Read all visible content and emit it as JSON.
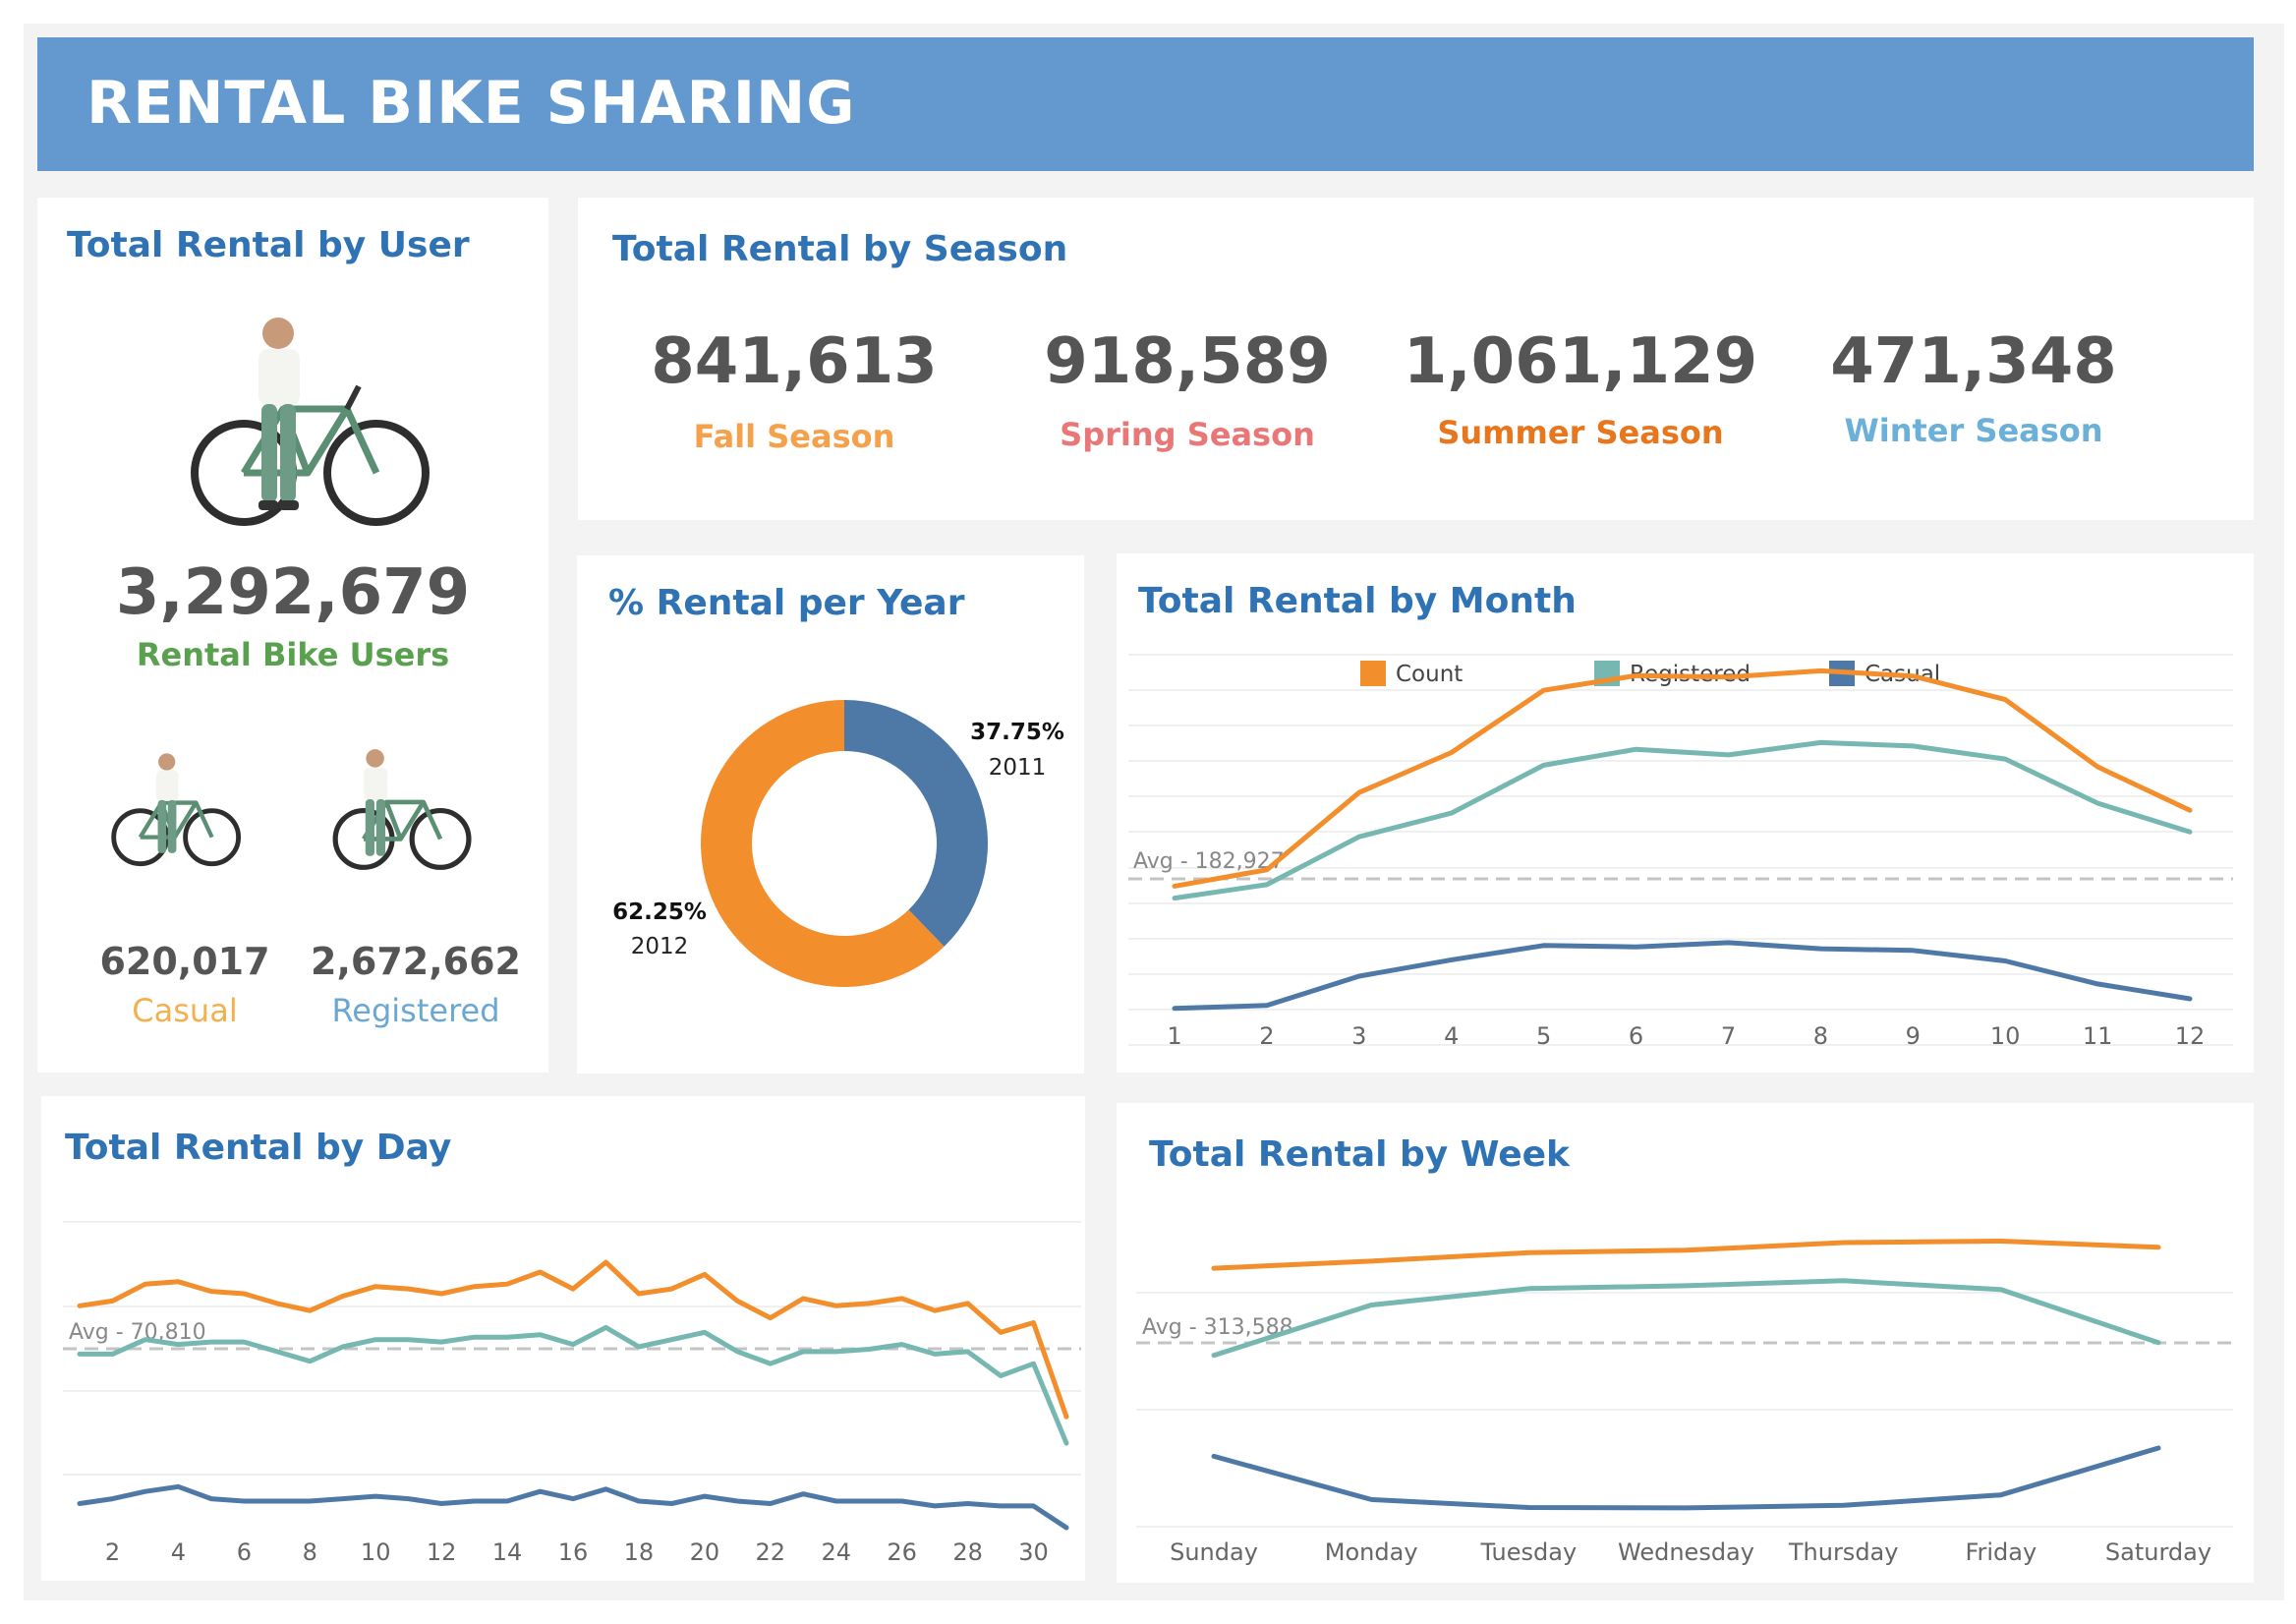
{
  "header": {
    "title": "RENTAL BIKE SHARING"
  },
  "colors": {
    "count": "#f28e2b",
    "registered": "#76b7b2",
    "casual": "#4e79a7",
    "title": "#2f73b4",
    "fall": "#f5a04a",
    "spring": "#ea7777",
    "summer": "#e8761c",
    "winter": "#6ab0d8",
    "users": "#59a14f",
    "casual_label": "#f2b04f",
    "registered_label": "#6aa7d3"
  },
  "user_panel": {
    "title": "Total Rental by User",
    "total": "3,292,679",
    "total_label": "Rental Bike Users",
    "casual_value": "620,017",
    "casual_label": "Casual",
    "registered_value": "2,672,662",
    "registered_label": "Registered",
    "figure_icon": "person-with-bike-icon"
  },
  "season_panel": {
    "title": "Total Rental by Season",
    "seasons": [
      {
        "value": "841,613",
        "label": "Fall Season"
      },
      {
        "value": "918,589",
        "label": "Spring Season"
      },
      {
        "value": "1,061,129",
        "label": "Summer Season"
      },
      {
        "value": "471,348",
        "label": "Winter Season"
      }
    ]
  },
  "year_panel": {
    "title": "% Rental per Year",
    "slices": [
      {
        "pct_label": "37.75%",
        "year": "2011"
      },
      {
        "pct_label": "62.25%",
        "year": "2012"
      }
    ]
  },
  "month_panel": {
    "title": "Total Rental by Month",
    "avg_label": "Avg - 182,927"
  },
  "day_panel": {
    "title": "Total Rental by Day",
    "avg_label": "Avg - 70,810"
  },
  "week_panel": {
    "title": "Total Rental by Week",
    "avg_label": "Avg - 313,588"
  },
  "legend": [
    "Count",
    "Registered",
    "Casual"
  ],
  "chart_data": [
    {
      "type": "pie",
      "title": "% Rental per Year",
      "categories": [
        "2011",
        "2012"
      ],
      "values": [
        37.75,
        62.25
      ]
    },
    {
      "type": "line",
      "title": "Total Rental by Month",
      "x": [
        "1",
        "2",
        "3",
        "4",
        "5",
        "6",
        "7",
        "8",
        "9",
        "10",
        "11",
        "12"
      ],
      "reference_line": 182927,
      "ylim": [
        0,
        400000
      ],
      "grid": true,
      "legend": "top",
      "series": [
        {
          "name": "Count",
          "values": [
            134933,
            151352,
            228920,
            269094,
            331686,
            346342,
            344948,
            351194,
            345991,
            322352,
            254831,
            211036
          ]
        },
        {
          "name": "Registered",
          "values": [
            122891,
            136389,
            184476,
            208292,
            256401,
            272436,
            266791,
            279155,
            275668,
            262592,
            218228,
            189343
          ]
        },
        {
          "name": "Casual",
          "values": [
            12042,
            14963,
            44444,
            60802,
            75285,
            73906,
            78157,
            72039,
            70323,
            59760,
            36603,
            21693
          ]
        }
      ]
    },
    {
      "type": "line",
      "title": "Total Rental by Day",
      "x": [
        1,
        2,
        3,
        4,
        5,
        6,
        7,
        8,
        9,
        10,
        11,
        12,
        13,
        14,
        15,
        16,
        17,
        18,
        19,
        20,
        21,
        22,
        23,
        24,
        25,
        26,
        27,
        28,
        29,
        30,
        31
      ],
      "reference_line": 70810,
      "ylim": [
        0,
        150000
      ],
      "grid": true,
      "series": [
        {
          "name": "Count",
          "values": [
            103000,
            105000,
            112000,
            113000,
            109000,
            108000,
            104000,
            101000,
            107000,
            111000,
            110000,
            108000,
            111000,
            112000,
            117000,
            110000,
            121000,
            108000,
            110000,
            116000,
            105000,
            98000,
            106000,
            103000,
            104000,
            106000,
            101000,
            104000,
            92000,
            96000,
            57000
          ]
        },
        {
          "name": "Registered",
          "values": [
            83000,
            83000,
            89000,
            87000,
            88000,
            88000,
            84000,
            80000,
            86000,
            89000,
            89000,
            88000,
            90000,
            90000,
            91000,
            87000,
            94000,
            86000,
            89000,
            92000,
            84000,
            79000,
            84000,
            84000,
            85000,
            87000,
            83000,
            84000,
            74000,
            79000,
            46000
          ]
        },
        {
          "name": "Casual",
          "values": [
            21000,
            23000,
            26000,
            28000,
            23000,
            22000,
            22000,
            22000,
            23000,
            24000,
            23000,
            21000,
            22000,
            22000,
            26000,
            23000,
            27000,
            22000,
            21000,
            24000,
            22000,
            21000,
            25000,
            22000,
            22000,
            22000,
            20000,
            21000,
            20000,
            20000,
            11000
          ]
        }
      ]
    },
    {
      "type": "line",
      "title": "Total Rental by Week",
      "categories": [
        "Sunday",
        "Monday",
        "Tuesday",
        "Wednesday",
        "Thursday",
        "Friday",
        "Saturday"
      ],
      "reference_line": 313588,
      "ylim": [
        0,
        560000
      ],
      "grid": true,
      "series": [
        {
          "name": "Count",
          "values": [
            444027,
            455503,
            469109,
            473048,
            485395,
            487790,
            477807
          ]
        },
        {
          "name": "Registered",
          "values": [
            303506,
            384719,
            411266,
            415729,
            423935,
            409552,
            323955
          ]
        },
        {
          "name": "Casual",
          "values": [
            140521,
            70784,
            57843,
            57319,
            61460,
            78238,
            153852
          ]
        }
      ]
    }
  ]
}
